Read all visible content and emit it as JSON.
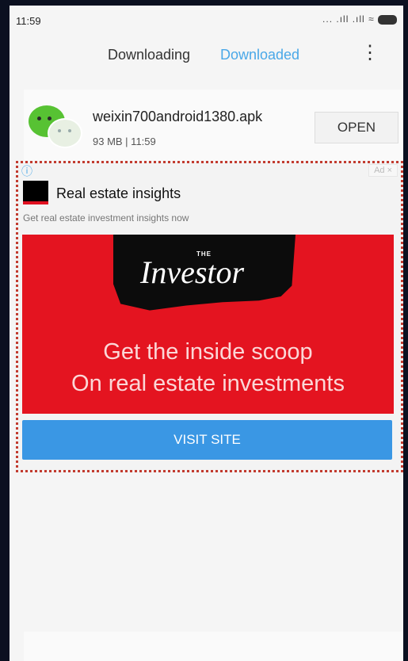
{
  "status": {
    "time": "11:59",
    "signal_icons": "... .ıll .ıll",
    "wifi_icon": "wifi-icon",
    "battery_icon": "battery-icon"
  },
  "tabs": {
    "downloading": "Downloading",
    "downloaded": "Downloaded",
    "active": "Downloaded",
    "menu_icon": "overflow-menu-icon"
  },
  "download": {
    "file_name": "weixin700android1380.apk",
    "meta": "93 MB | 11:59",
    "open_label": "OPEN",
    "icon": "wechat-icon"
  },
  "ad": {
    "info_icon": "ⓘ",
    "ad_tag": "Ad ×",
    "title": "Real estate insights",
    "subtitle": "Get real estate investment insights now",
    "brand_small": "THE",
    "brand_name": "Investor",
    "headline_1": "Get the inside scoop",
    "headline_2": "On real estate investments",
    "cta_label": "VISIT SITE"
  },
  "colors": {
    "accent": "#4aa8e8",
    "ad_banner": "#e41420",
    "cta": "#3a97e4",
    "highlight_border": "#c23b2f"
  }
}
